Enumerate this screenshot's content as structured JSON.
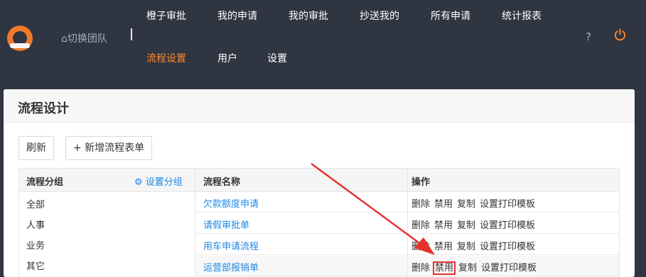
{
  "header": {
    "team_label": "⌂切换团队",
    "nav_row1": [
      "橙子审批",
      "我的申请",
      "我的审批",
      "抄送我的",
      "所有申请",
      "统计报表"
    ],
    "nav_row2": [
      "流程设置",
      "用户",
      "设置"
    ],
    "help_glyph": "?",
    "accent": "#ff8a2a"
  },
  "panel": {
    "title": "流程设计",
    "refresh": "刷新",
    "add_form": "+ 新增流程表单"
  },
  "groups": {
    "header": "流程分组",
    "settings": "⚙ 设置分组",
    "items": [
      "全部",
      "人事",
      "业务",
      "其它"
    ]
  },
  "flows": {
    "col_name": "流程名称",
    "col_ops": "操作",
    "rows": [
      {
        "name": "欠款额度申请",
        "ops": [
          "删除",
          "禁用",
          "复制",
          "设置打印模板"
        ]
      },
      {
        "name": "请假审批单",
        "ops": [
          "删除",
          "禁用",
          "复制",
          "设置打印模板"
        ]
      },
      {
        "name": "用车申请流程",
        "ops": [
          "删除",
          "禁用",
          "复制",
          "设置打印模板"
        ]
      },
      {
        "name": "运营部报销单",
        "ops": [
          "删除",
          "禁用",
          "复制",
          "设置打印模板"
        ]
      }
    ]
  }
}
